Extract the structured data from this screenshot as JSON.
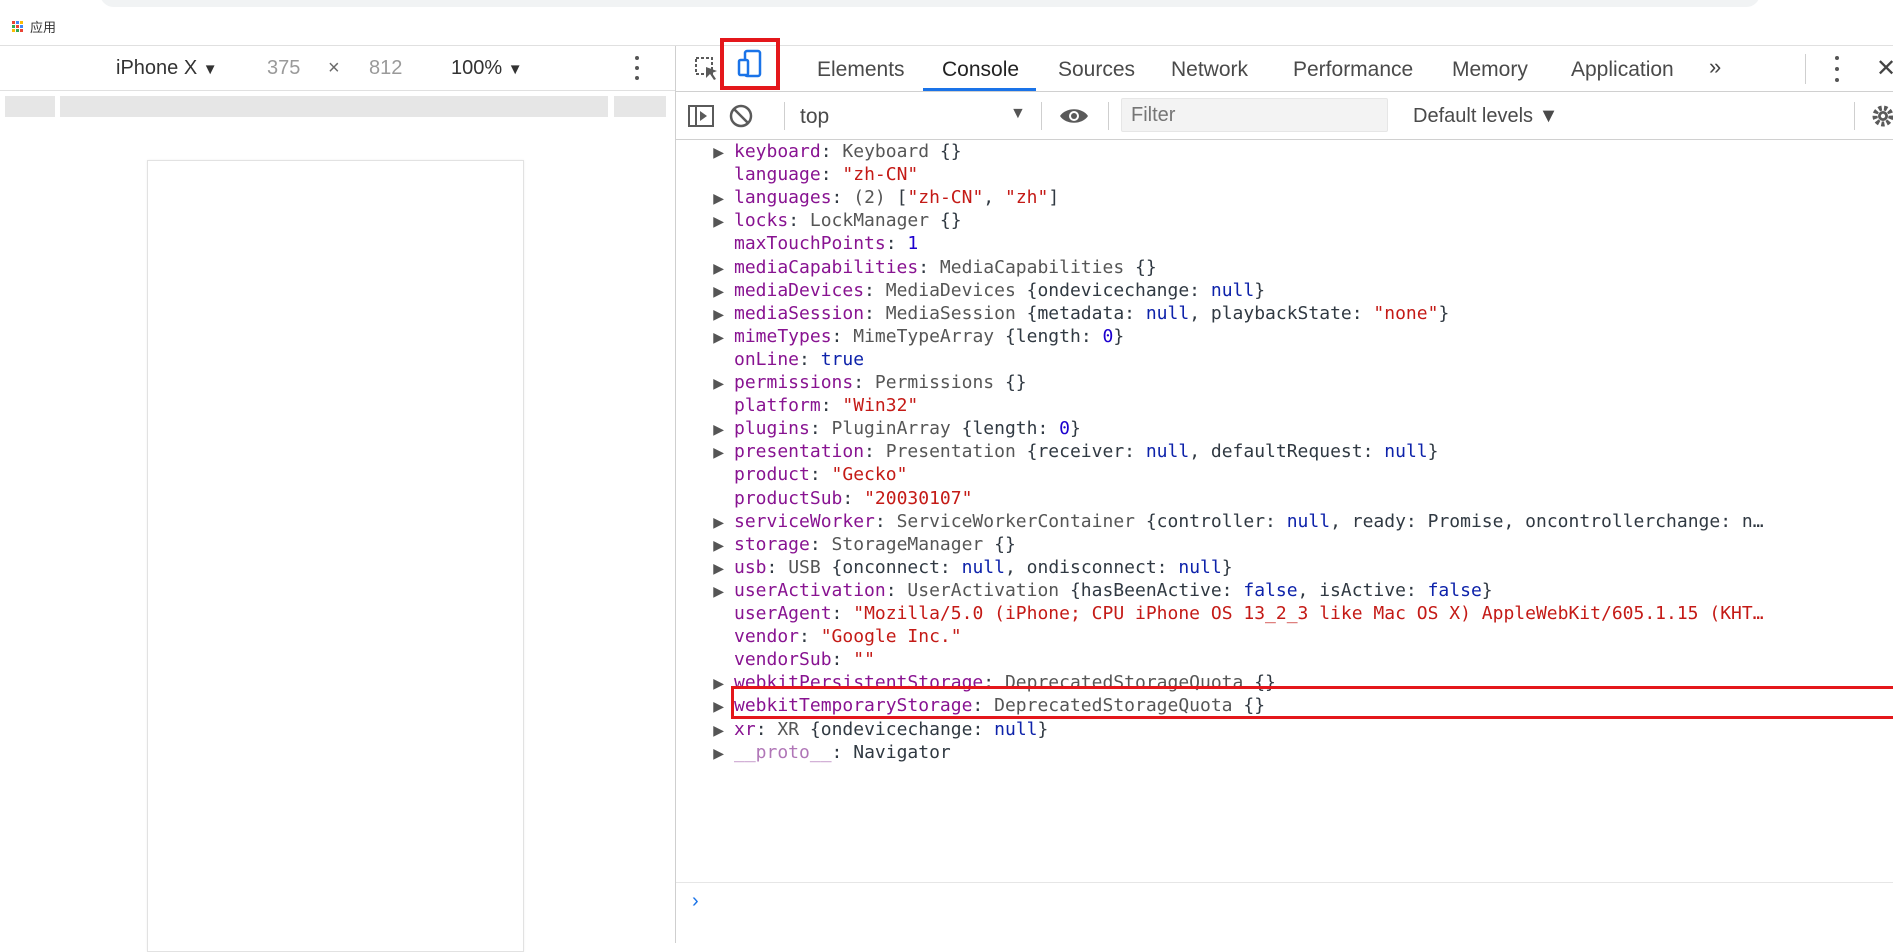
{
  "bookmarks": {
    "apps_label": "应用"
  },
  "device_toolbar": {
    "model": "iPhone X",
    "model_arrow": "▼",
    "width": "375",
    "times": "×",
    "height": "812",
    "zoom": "100%",
    "zoom_arrow": "▼"
  },
  "devtools": {
    "tabs": [
      "Elements",
      "Console",
      "Sources",
      "Network",
      "Performance",
      "Memory",
      "Application"
    ],
    "more_tabs": "»",
    "close": "✕",
    "console_toolbar": {
      "context": "top",
      "context_arrow": "▼",
      "filter_placeholder": "Filter",
      "levels": "Default levels ▼"
    }
  },
  "console_rows": [
    [
      "keyboard",
      ": ",
      "Keyboard {}"
    ],
    [
      "language",
      ": ",
      "\"zh-CN\""
    ],
    [
      "languages",
      ": ",
      "(2) [\"zh-CN\", \"zh\"]"
    ],
    [
      "locks",
      ": ",
      "LockManager {}"
    ],
    [
      "maxTouchPoints",
      ": ",
      "1"
    ],
    [
      "mediaCapabilities",
      ": ",
      "MediaCapabilities {}"
    ],
    [
      "mediaDevices",
      ": ",
      "MediaDevices {ondevicechange: null}"
    ],
    [
      "mediaSession",
      ": ",
      "MediaSession {metadata: null, playbackState: \"none\"}"
    ],
    [
      "mimeTypes",
      ": ",
      "MimeTypeArray {length: 0}"
    ],
    [
      "onLine",
      ": ",
      "true"
    ],
    [
      "permissions",
      ": ",
      "Permissions {}"
    ],
    [
      "platform",
      ": ",
      "\"Win32\""
    ],
    [
      "plugins",
      ": ",
      "PluginArray {length: 0}"
    ],
    [
      "presentation",
      ": ",
      "Presentation {receiver: null, defaultRequest: null}"
    ],
    [
      "product",
      ": ",
      "\"Gecko\""
    ],
    [
      "productSub",
      ": ",
      "\"20030107\""
    ],
    [
      "serviceWorker",
      ": ",
      "ServiceWorkerContainer {controller: null, ready: Promise, oncontrollerchange: n…"
    ],
    [
      "storage",
      ": ",
      "StorageManager {}"
    ],
    [
      "usb",
      ": ",
      "USB {onconnect: null, ondisconnect: null}"
    ],
    [
      "userActivation",
      ": ",
      "UserActivation {hasBeenActive: false, isActive: false}"
    ],
    [
      "userAgent",
      ": ",
      "\"Mozilla/5.0 (iPhone; CPU iPhone OS 13_2_3 like Mac OS X) AppleWebKit/605.1.15 (KHT…"
    ],
    [
      "vendor",
      ": ",
      "\"Google Inc.\""
    ],
    [
      "vendorSub",
      ": ",
      "\"\""
    ],
    [
      "webkitPersistentStorage",
      ": ",
      "DeprecatedStorageQuota {}"
    ],
    [
      "webkitTemporaryStorage",
      ": ",
      "DeprecatedStorageQuota {}"
    ],
    [
      "xr",
      ": ",
      "XR {ondevicechange: null}"
    ],
    [
      "__proto__",
      ": ",
      "Navigator"
    ]
  ],
  "prompt_symbol": "›",
  "colors": {
    "highlight": "#e4171b",
    "accent": "#1a73e8",
    "key": "#881391",
    "string": "#c41a16",
    "number": "#1c00cf"
  }
}
